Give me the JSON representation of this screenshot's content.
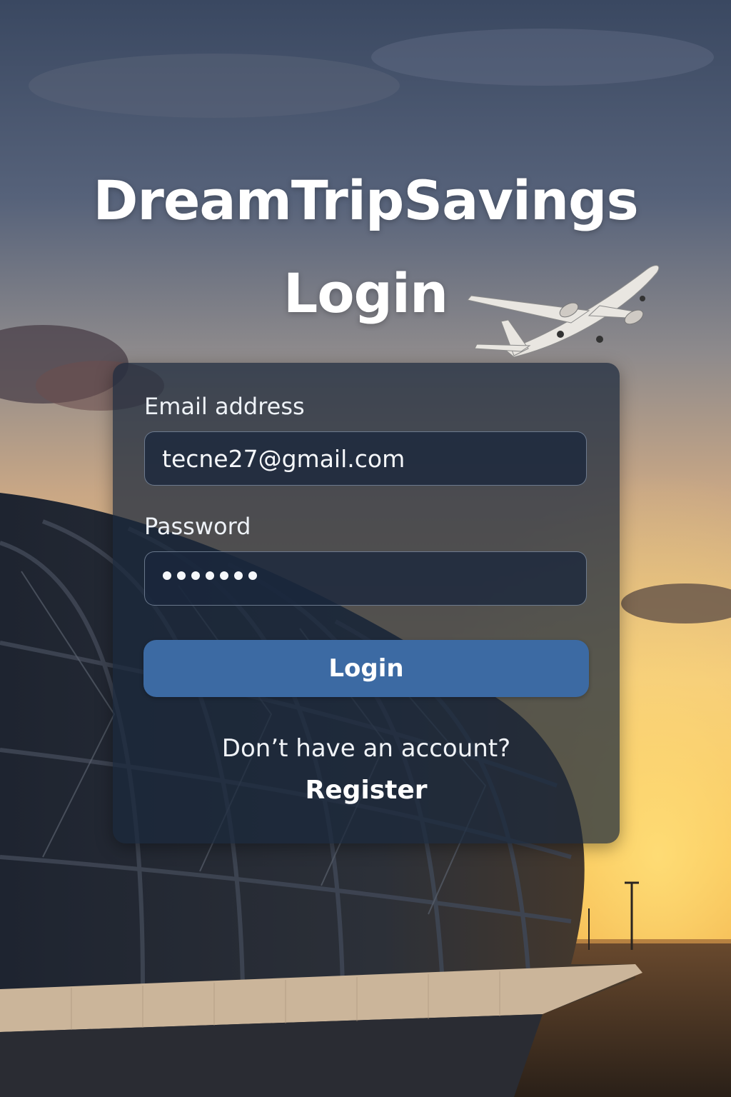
{
  "app": {
    "title_line_1": "DreamTripSavings",
    "title_line_2": "Login"
  },
  "form": {
    "email_label": "Email address",
    "email_value": "tecne27@gmail.com",
    "password_label": "Password",
    "password_dot_count": 7,
    "login_button_label": "Login"
  },
  "footer": {
    "no_account_text": "Don’t have an account?",
    "register_label": "Register"
  },
  "colors": {
    "button": "#3c6aa3",
    "card": "#1b283c",
    "sky_top": "#3c4a63",
    "sky_horizon": "#f5b24a"
  },
  "icons": {
    "airplane": "airplane-icon"
  }
}
